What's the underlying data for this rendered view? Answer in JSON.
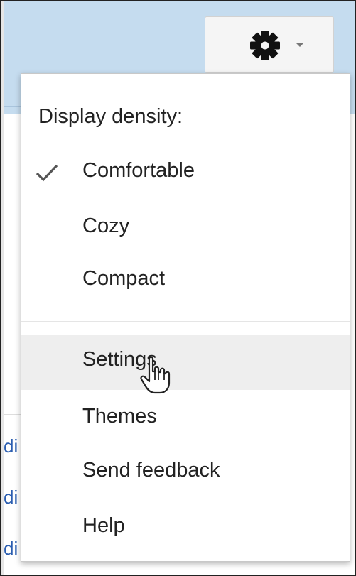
{
  "menu": {
    "heading": "Display density:",
    "density_options": [
      {
        "label": "Comfortable",
        "checked": true
      },
      {
        "label": "Cozy",
        "checked": false
      },
      {
        "label": "Compact",
        "checked": false
      }
    ],
    "actions": [
      {
        "label": "Settings",
        "hovered": true
      },
      {
        "label": "Themes",
        "hovered": false
      },
      {
        "label": "Send feedback",
        "hovered": false
      },
      {
        "label": "Help",
        "hovered": false
      }
    ]
  },
  "background": {
    "link_fragments": [
      "di",
      "di",
      "di"
    ]
  },
  "icons": {
    "settings": "gear-icon",
    "dropdown": "caret-down-icon",
    "selected": "checkmark-icon",
    "pointer": "hand-cursor-icon"
  },
  "colors": {
    "header_band": "#c5dcef",
    "hover_row": "#eeeeee",
    "link": "#2a5db0"
  }
}
